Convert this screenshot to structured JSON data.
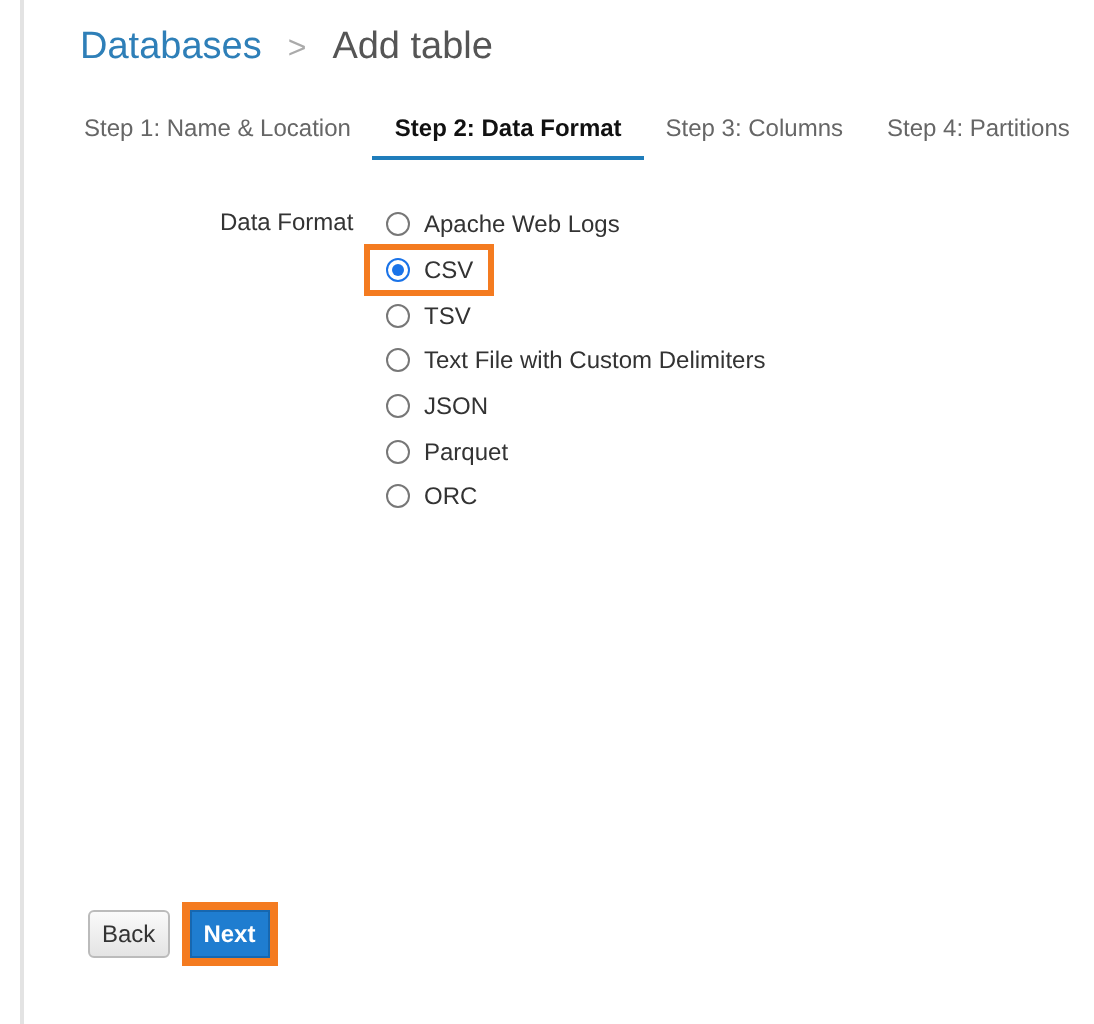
{
  "breadcrumb": {
    "parent": "Databases",
    "separator": ">",
    "current": "Add table"
  },
  "tabs": [
    {
      "label": "Step 1: Name & Location",
      "selected": false
    },
    {
      "label": "Step 2: Data Format",
      "selected": true
    },
    {
      "label": "Step 3: Columns",
      "selected": false
    },
    {
      "label": "Step 4: Partitions",
      "selected": false
    }
  ],
  "data_format": {
    "label": "Data Format",
    "options": [
      {
        "label": "Apache Web Logs",
        "selected": false,
        "highlighted": false
      },
      {
        "label": "CSV",
        "selected": true,
        "highlighted": true
      },
      {
        "label": "TSV",
        "selected": false,
        "highlighted": false
      },
      {
        "label": "Text File with Custom Delimiters",
        "selected": false,
        "highlighted": false
      },
      {
        "label": "JSON",
        "selected": false,
        "highlighted": false
      },
      {
        "label": "Parquet",
        "selected": false,
        "highlighted": false
      },
      {
        "label": "ORC",
        "selected": false,
        "highlighted": false
      }
    ]
  },
  "buttons": [
    {
      "label": "Back",
      "kind": "secondary",
      "highlighted": false
    },
    {
      "label": "Next",
      "kind": "primary",
      "highlighted": true
    }
  ]
}
